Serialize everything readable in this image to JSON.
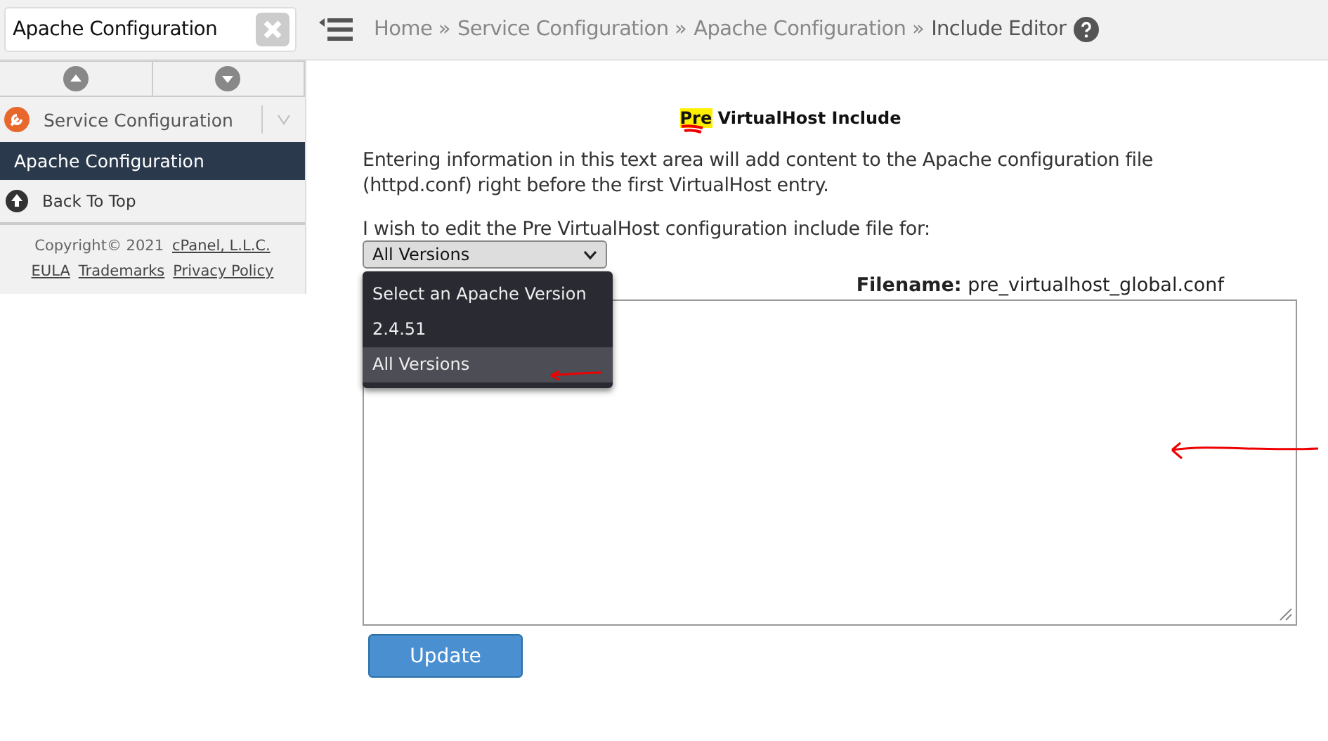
{
  "search": {
    "value": "Apache Configuration"
  },
  "breadcrumb": [
    "Home »",
    "Service Configuration »",
    "Apache Configuration »",
    "Include Editor"
  ],
  "sidebar": {
    "category": "Service Configuration",
    "items": [
      {
        "label": "Apache Configuration",
        "selected": true
      }
    ],
    "back_to_top": "Back To Top",
    "copyright": "Copyright© 2021",
    "company_link": "cPanel, L.L.C.",
    "links": [
      "EULA",
      "Trademarks",
      "Privacy Policy"
    ]
  },
  "heading": {
    "highlight": "Pre",
    "text": "VirtualHost Include"
  },
  "description": "Entering information in this text area will add content to the Apache configuration file (httpd.conf) right before the first VirtualHost entry.",
  "select_label": "I wish to edit the Pre VirtualHost configuration include file for:",
  "select": {
    "value": "All Versions",
    "options": [
      {
        "label": "Select an Apache Version",
        "selected": false
      },
      {
        "label": "2.4.51",
        "selected": false
      },
      {
        "label": "All Versions",
        "selected": true
      }
    ]
  },
  "filename": {
    "label": "Filename:",
    "value": "pre_virtualhost_global.conf"
  },
  "update_button": "Update"
}
